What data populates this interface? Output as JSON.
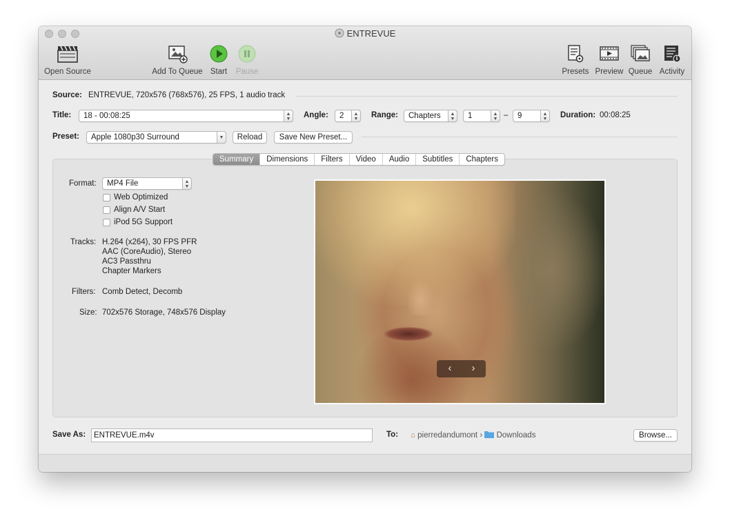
{
  "window": {
    "title": "ENTREVUE"
  },
  "toolbar": {
    "open_source": "Open Source",
    "add_to_queue": "Add To Queue",
    "start": "Start",
    "pause": "Pause",
    "presets": "Presets",
    "preview": "Preview",
    "queue": "Queue",
    "activity": "Activity"
  },
  "source": {
    "label": "Source:",
    "value": "ENTREVUE, 720x576 (768x576), 25 FPS, 1 audio track"
  },
  "title_row": {
    "title_label": "Title:",
    "title_value": "18 - 00:08:25",
    "angle_label": "Angle:",
    "angle_value": "2",
    "range_label": "Range:",
    "range_type": "Chapters",
    "range_from": "1",
    "range_dash": "–",
    "range_to": "9",
    "duration_label": "Duration:",
    "duration_value": "00:08:25"
  },
  "preset_row": {
    "preset_label": "Preset:",
    "preset_value": "Apple 1080p30 Surround",
    "reload": "Reload",
    "save_new_preset": "Save New Preset..."
  },
  "tabs": [
    "Summary",
    "Dimensions",
    "Filters",
    "Video",
    "Audio",
    "Subtitles",
    "Chapters"
  ],
  "summary": {
    "format_label": "Format:",
    "format_value": "MP4 File",
    "web_optimized": "Web Optimized",
    "align_av": "Align A/V Start",
    "ipod": "iPod 5G Support",
    "tracks_label": "Tracks:",
    "tracks": [
      "H.264 (x264), 30 FPS PFR",
      "AAC (CoreAudio), Stereo",
      "AC3 Passthru",
      "Chapter Markers"
    ],
    "filters_label": "Filters:",
    "filters_value": "Comb Detect, Decomb",
    "size_label": "Size:",
    "size_value": "702x576 Storage, 748x576 Display"
  },
  "preview_nav": {
    "prev": "‹",
    "next": "›"
  },
  "save": {
    "label": "Save As:",
    "filename": "ENTREVUE.m4v",
    "to_label": "To:",
    "user": "pierredandumont",
    "path_sep": "›",
    "folder": "Downloads",
    "browse": "Browse..."
  },
  "colors": {
    "tab_active": "#8c8c8c",
    "start_green": "#3fae2a",
    "folder_blue": "#58a6e0"
  }
}
